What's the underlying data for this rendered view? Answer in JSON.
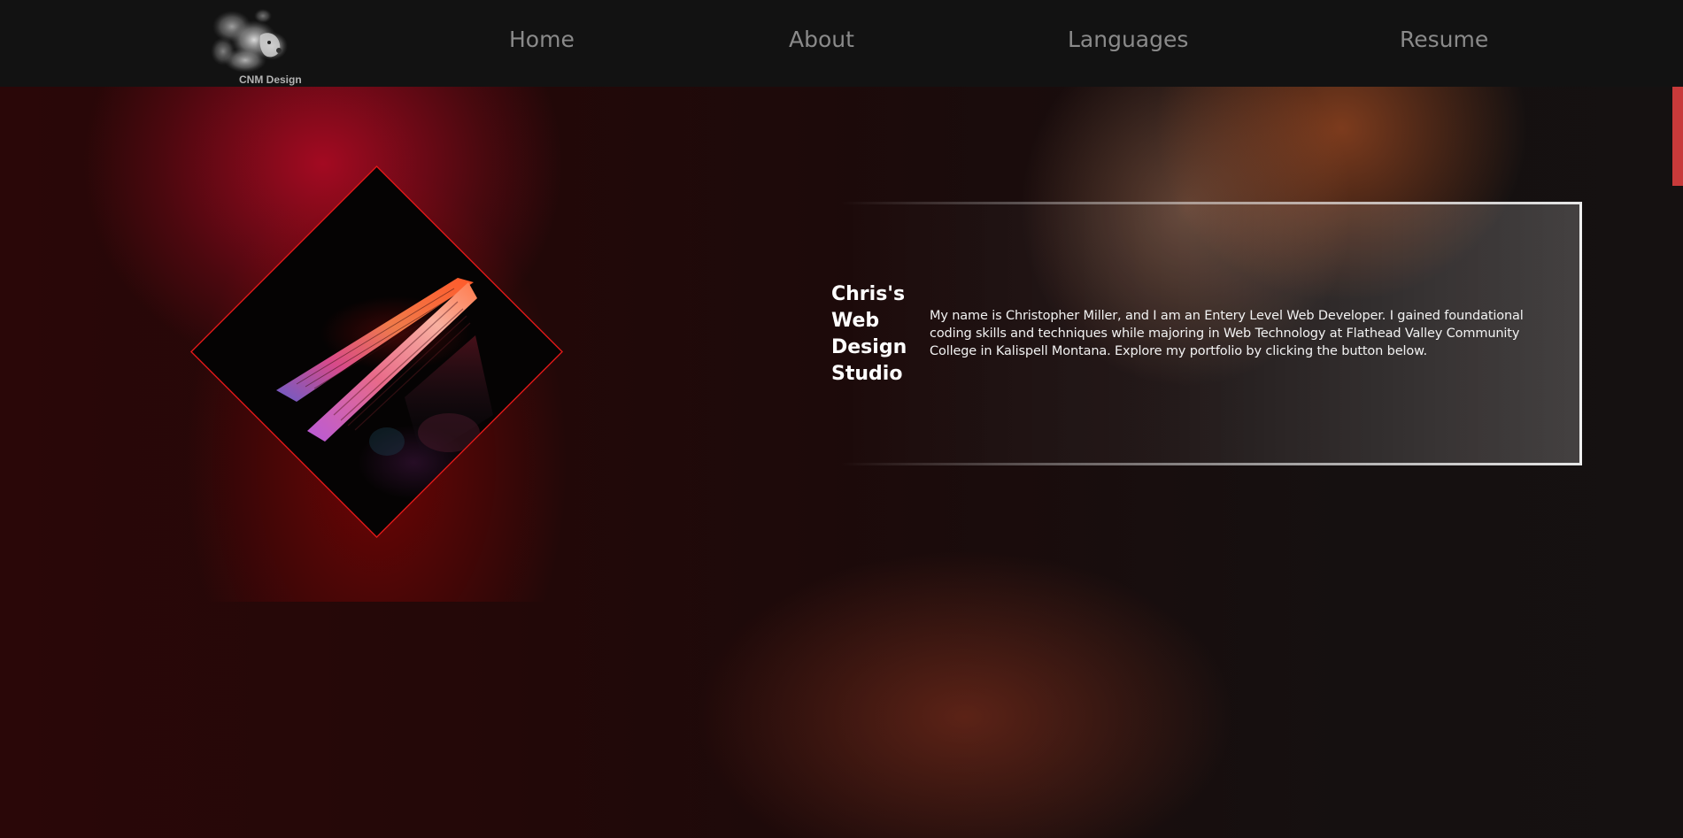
{
  "header": {
    "logo": {
      "icon": "smoke-dog-logo-icon",
      "text": "CNM Design"
    },
    "nav": [
      {
        "label": "Home"
      },
      {
        "label": "About"
      },
      {
        "label": "Languages"
      },
      {
        "label": "Resume"
      }
    ]
  },
  "hero": {
    "image_icon": "laptop-image",
    "title": "Chris's Web Design Studio",
    "intro": "My name is Christopher Miller, and I am an Entery Level Web Developer. I gained foundational coding skills and techniques while majoring in Web Technology at Flathead Valley Community College in Kalispell Montana. Explore my portfolio by clicking the button below."
  },
  "colors": {
    "nav_background": "#121212",
    "nav_text": "#8a8a8a",
    "accent_red": "#e01818",
    "scrollbar_thumb": "#c83a3a",
    "card_border": "#f0f0f0"
  }
}
